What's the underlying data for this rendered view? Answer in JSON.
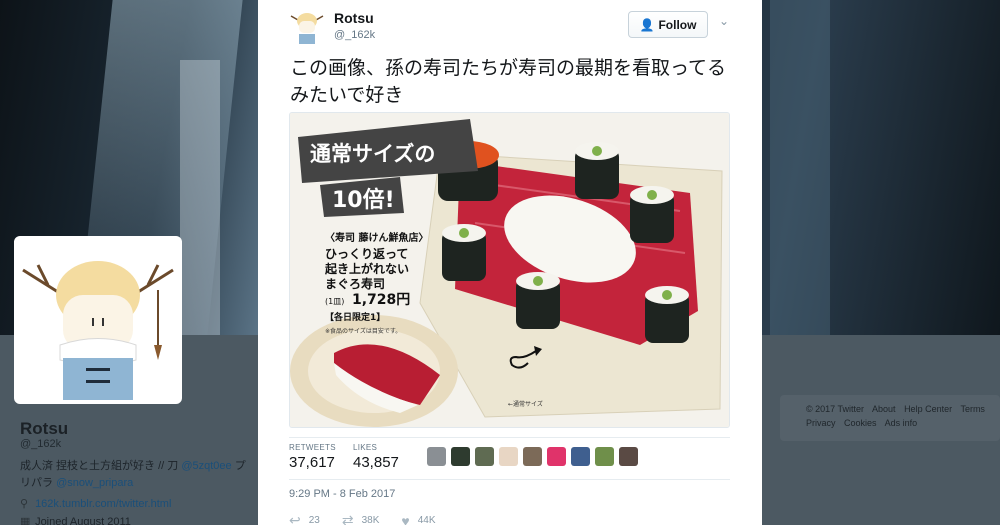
{
  "profile": {
    "name": "Rotsu",
    "handle": "@_162k",
    "bio_line1": "成人済 捏枝と土方組が好き // 刀",
    "bio_link1": "@5zqt0ee",
    "bio_tail1": " プ",
    "bio_line2": "リパラ",
    "bio_link2": "@snow_pripara",
    "website": "162k.tumblr.com/twitter.html",
    "joined": "Joined August 2011"
  },
  "footer": {
    "items": [
      "© 2017 Twitter",
      "About",
      "Help Center",
      "Terms",
      "Privacy",
      "Cookies",
      "Ads info"
    ]
  },
  "tweet": {
    "name": "Rotsu",
    "handle": "@_162k",
    "follow_label": "Follow",
    "text": "この画像、孫の寿司たちが寿司の最期を看取ってるみたいで好き",
    "retweets_label": "RETWEETS",
    "retweets": "37,617",
    "likes_label": "LIKES",
    "likes": "43,857",
    "timestamp": "9:29 PM - 8 Feb 2017",
    "reply_count": "23",
    "retweet_count": "38K",
    "like_count": "44K"
  },
  "photo": {
    "headline1": "通常サイズの",
    "headline2": "10倍!",
    "shop": "〈寿司 藤けん鮮魚店〉",
    "desc1": "ひっくり返って",
    "desc2": "起き上がれない",
    "desc3": "まぐろ寿司",
    "price_prefix": "(1皿)",
    "price": "1,728円",
    "limit": "【各日限定1】",
    "note": "※食品のサイズは目安です。",
    "normal_size": "←通常サイズ"
  },
  "likers": [
    {
      "icon": "liker-avatar-icon",
      "color": "#8a8f94"
    },
    {
      "icon": "liker-avatar-icon",
      "color": "#2e3b2f"
    },
    {
      "icon": "liker-avatar-icon",
      "color": "#5f6b52"
    },
    {
      "icon": "liker-avatar-icon",
      "color": "#e8d6c4"
    },
    {
      "icon": "liker-avatar-icon",
      "color": "#7c6a58"
    },
    {
      "icon": "liker-avatar-icon",
      "color": "#e0336a"
    },
    {
      "icon": "liker-avatar-icon",
      "color": "#3f5f8f"
    },
    {
      "icon": "liker-avatar-icon",
      "color": "#6f8f4a"
    },
    {
      "icon": "liker-avatar-icon",
      "color": "#5a4a44"
    }
  ],
  "colors": {
    "accent": "#1da1f2",
    "tuna": "#c2243a",
    "rice": "#f7f6f1"
  }
}
